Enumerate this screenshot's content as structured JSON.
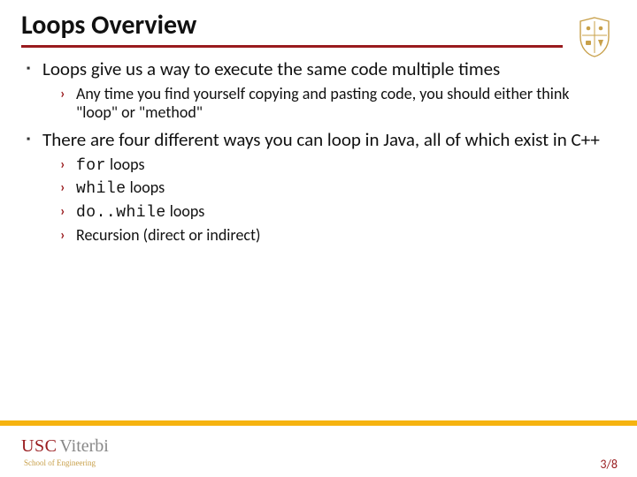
{
  "title": "Loops Overview",
  "bullets": [
    {
      "text": "Loops give us a way to execute the same code multiple times",
      "sub": [
        {
          "text": "Any time you find yourself copying and pasting code, you should either think \"loop\" or \"method\""
        }
      ]
    },
    {
      "text": "There are four different ways you can loop in Java, all of which exist in C++",
      "sub": [
        {
          "code": "for",
          "suffix": " loops"
        },
        {
          "code": "while",
          "suffix": " loops"
        },
        {
          "code": "do..while",
          "suffix": " loops"
        },
        {
          "text": "Recursion (direct or indirect)"
        }
      ]
    }
  ],
  "logo": {
    "usc": "USC",
    "viterbi": "Viterbi",
    "sub": "School of Engineering"
  },
  "page": "3/8"
}
